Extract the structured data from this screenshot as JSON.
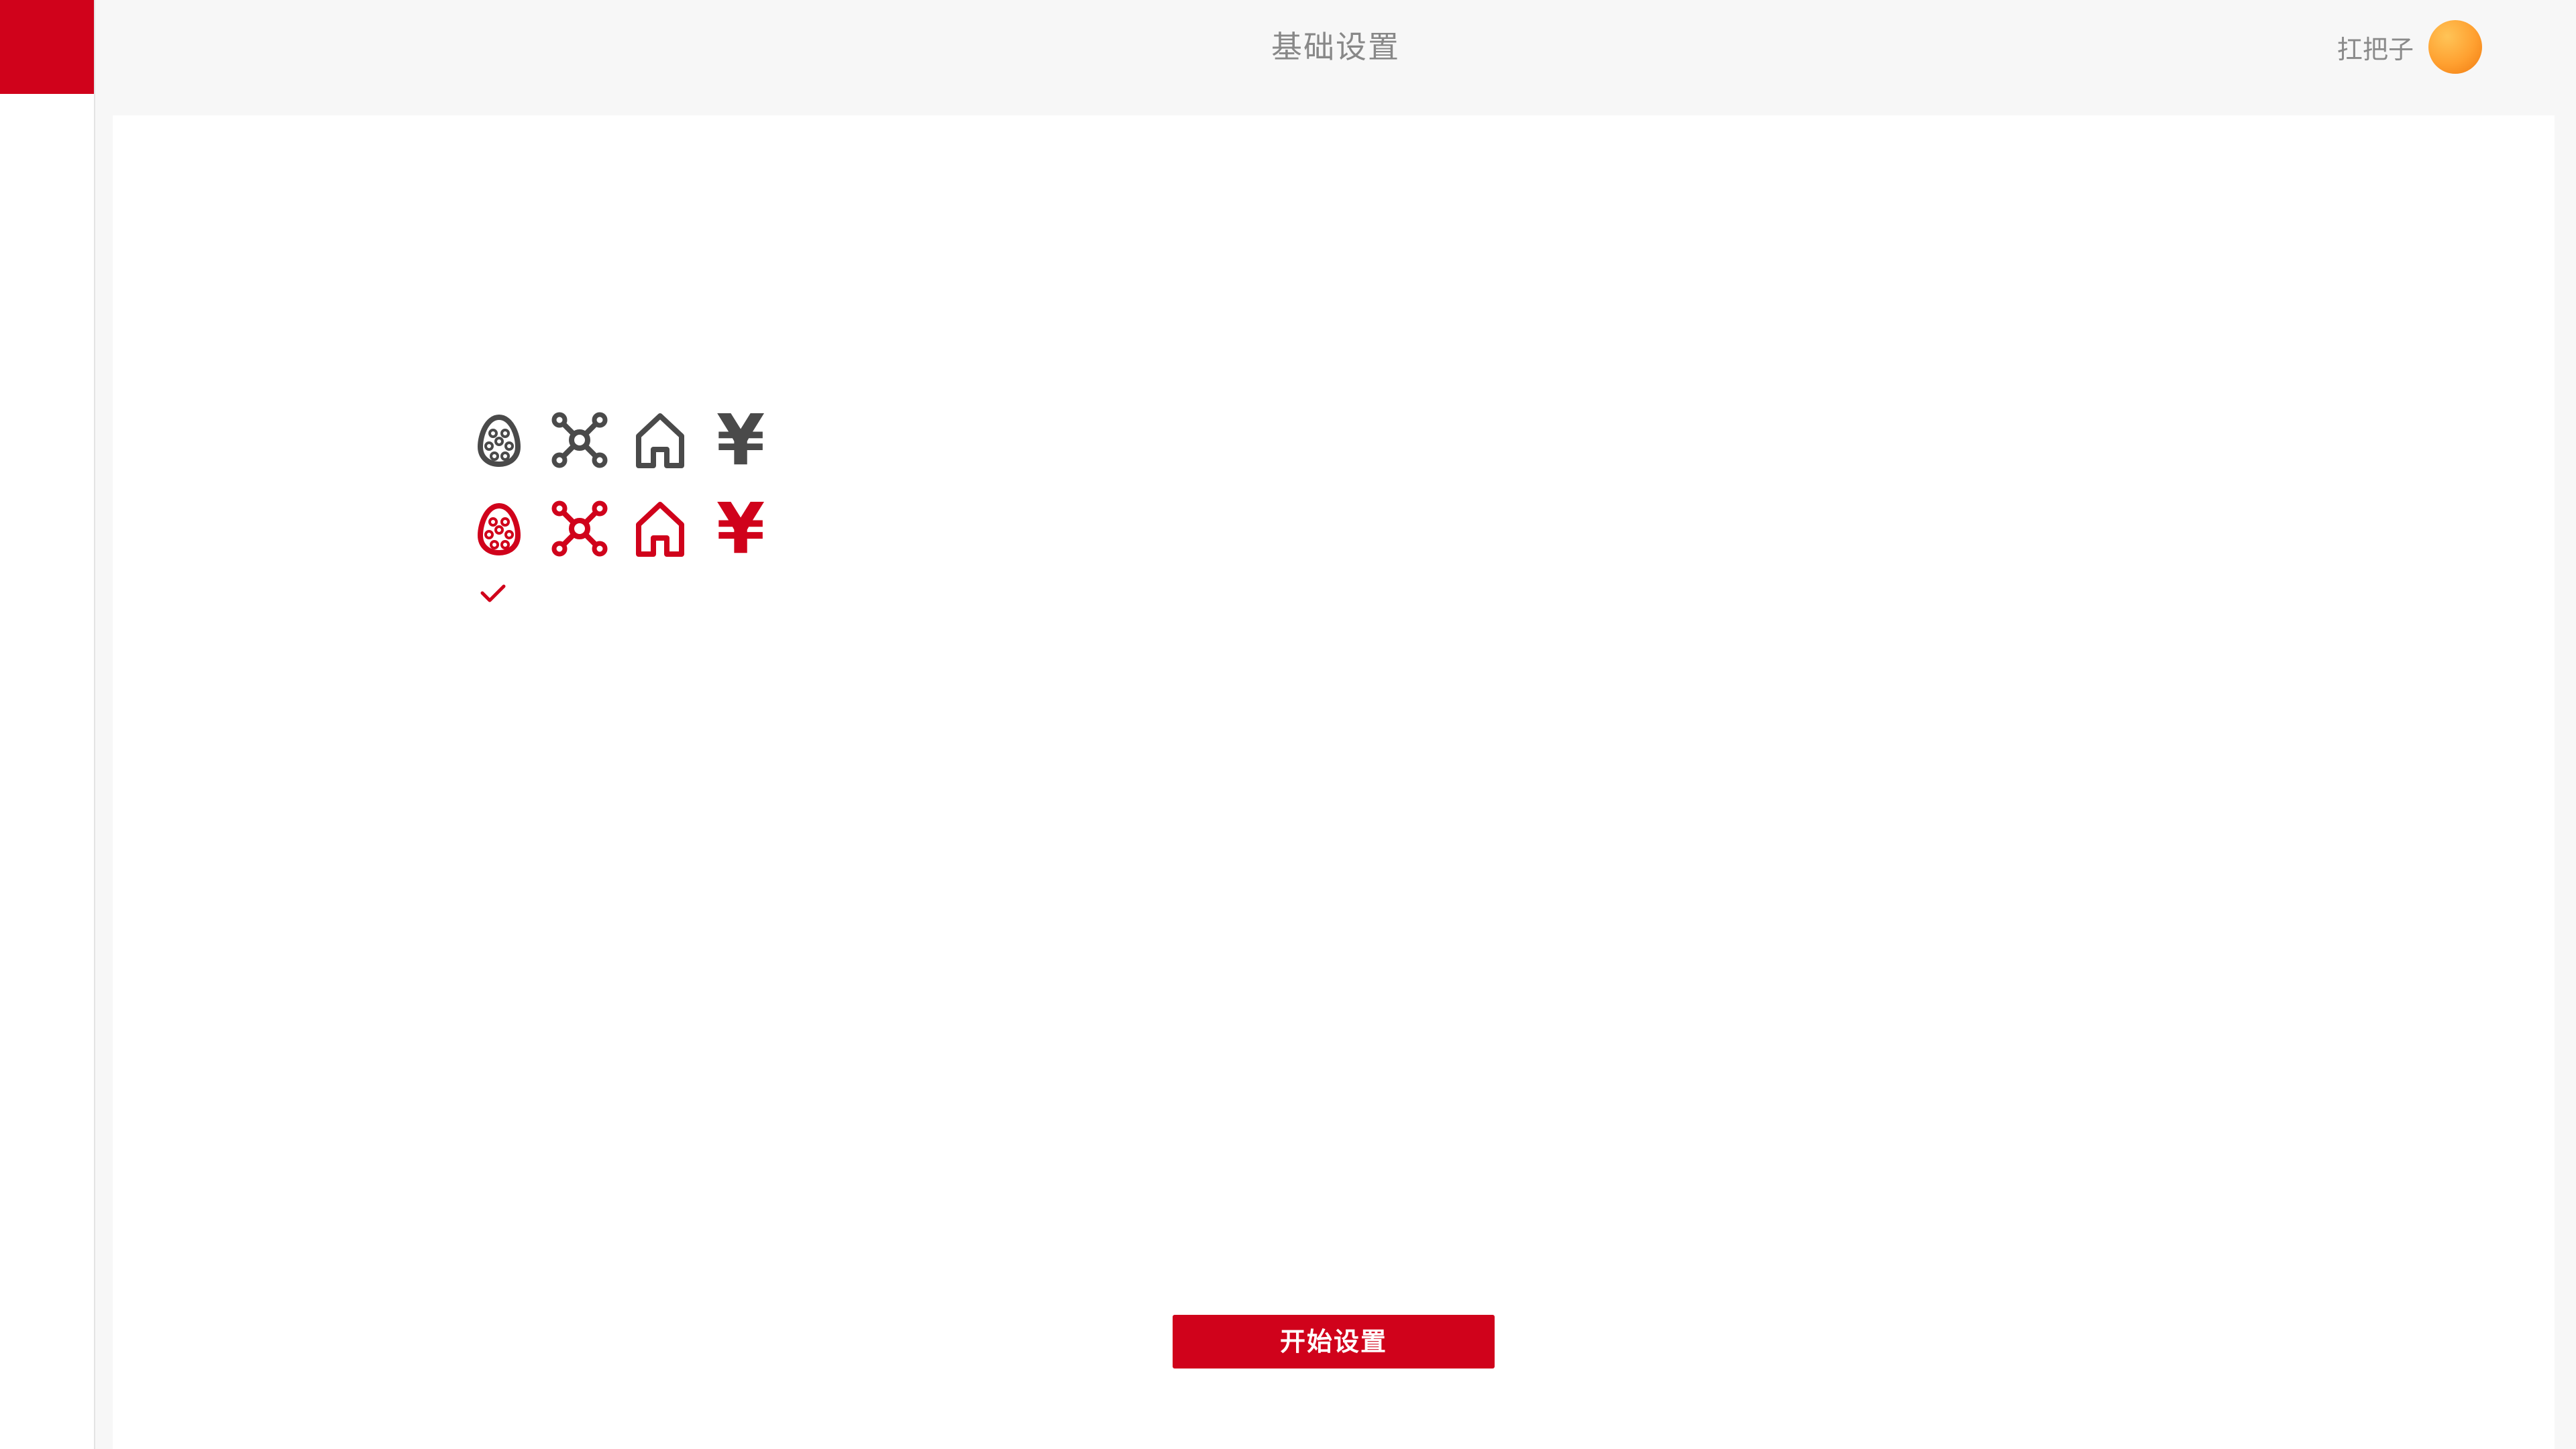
{
  "header": {
    "title": "基础设置",
    "user_name": "扛把子"
  },
  "icons": {
    "dark_row": [
      "egg-icon",
      "drone-icon",
      "home-icon",
      "yen-icon"
    ],
    "red_row": [
      "egg-icon",
      "drone-icon",
      "home-icon",
      "yen-icon"
    ],
    "yen_symbol": "¥",
    "selected_indicator": "check-icon"
  },
  "main": {
    "start_button_label": "开始设置"
  },
  "colors": {
    "accent": "#d0021b",
    "icon_dark": "#4a4a4a",
    "avatar": "#ffa030",
    "header_bg": "#f7f7f7",
    "content_bg": "#ffffff"
  }
}
